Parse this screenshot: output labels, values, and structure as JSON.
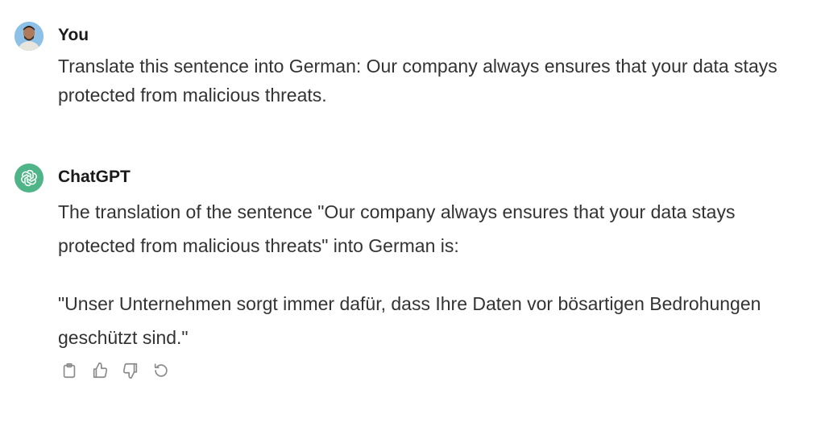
{
  "conversation": {
    "user_message": {
      "author": "You",
      "avatar_icon": "user-avatar",
      "text": "Translate this sentence into German: Our company always ensures that your data stays protected from malicious threats."
    },
    "assistant_message": {
      "author": "ChatGPT",
      "avatar_icon": "openai-logo-icon",
      "avatar_color": "#4fb487",
      "paragraphs": [
        "The translation of the sentence \"Our company always ensures that your data stays protected from malicious threats\" into German is:",
        "\"Unser Unternehmen sorgt immer dafür, dass Ihre Daten vor bösartigen Bedrohungen geschützt sind.\""
      ],
      "actions": [
        {
          "name": "copy",
          "icon": "clipboard-icon"
        },
        {
          "name": "like",
          "icon": "thumbs-up-icon"
        },
        {
          "name": "dislike",
          "icon": "thumbs-down-icon"
        },
        {
          "name": "regenerate",
          "icon": "regenerate-icon"
        }
      ]
    }
  }
}
